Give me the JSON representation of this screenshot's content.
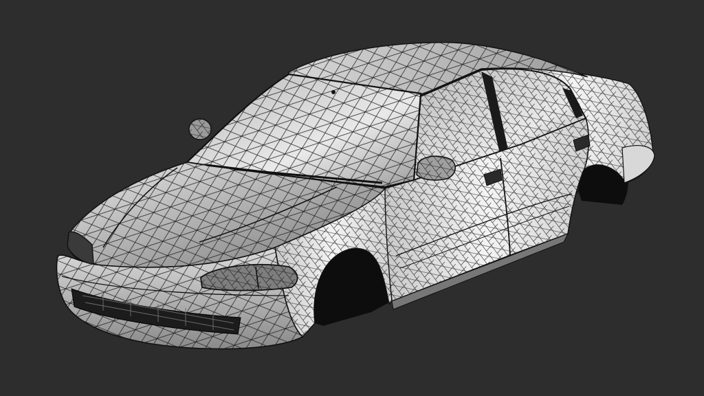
{
  "scene": {
    "background_color": "#2d2d2d",
    "subject": "car-body-wireframe-render",
    "body_fill_light": "#f2f2f2",
    "body_fill_mid": "#bdbdbd",
    "body_fill_dark": "#6f6f6f",
    "wire_color": "#111111",
    "interior_color": "#0d0d0d"
  }
}
